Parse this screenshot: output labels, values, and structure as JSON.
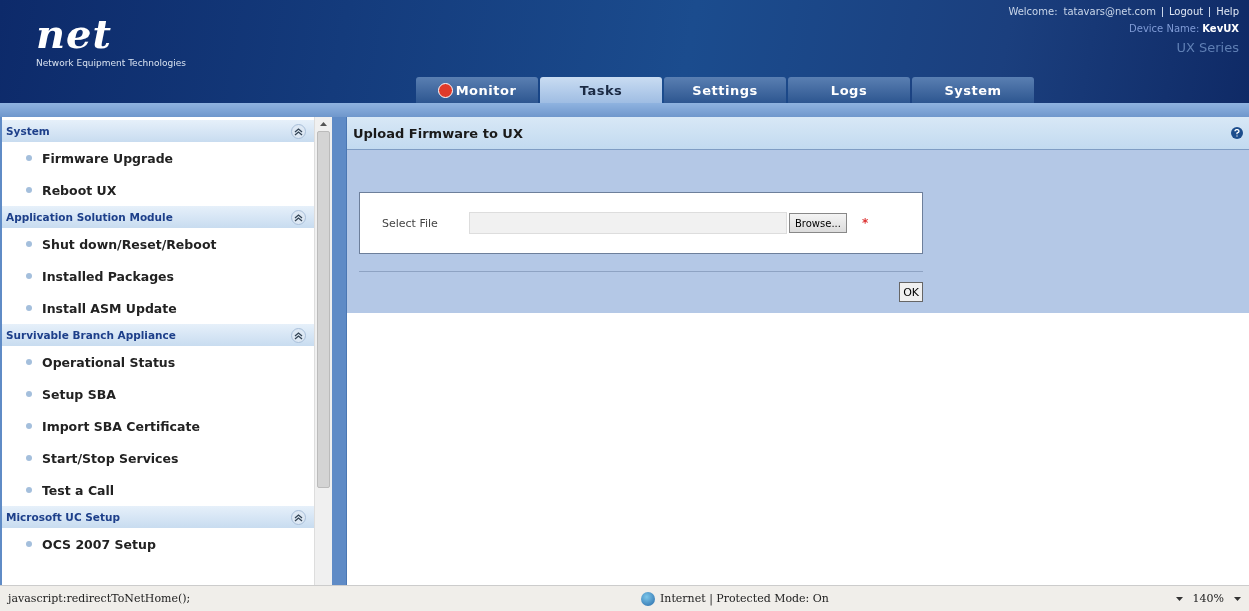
{
  "brand": {
    "logo": "net",
    "tagline": "Network Equipment Technologies"
  },
  "user_bar": {
    "welcome": "Welcome:",
    "user": "tatavars@net.com",
    "links": [
      "Logout",
      "Help"
    ],
    "device_label": "Device Name:",
    "device_name": "KevUX",
    "series": "UX Series"
  },
  "tabs": [
    {
      "label": "Monitor",
      "selected": false,
      "alert": true
    },
    {
      "label": "Tasks",
      "selected": true,
      "alert": false
    },
    {
      "label": "Settings",
      "selected": false,
      "alert": false
    },
    {
      "label": "Logs",
      "selected": false,
      "alert": false
    },
    {
      "label": "System",
      "selected": false,
      "alert": false
    }
  ],
  "sidebar": {
    "sections": [
      {
        "title": "System",
        "expanded": true,
        "items": [
          "Firmware Upgrade",
          "Reboot UX"
        ]
      },
      {
        "title": "Application Solution Module",
        "expanded": true,
        "items": [
          "Shut down/Reset/Reboot",
          "Installed Packages",
          "Install ASM Update"
        ]
      },
      {
        "title": "Survivable Branch Appliance",
        "expanded": true,
        "items": [
          "Operational Status",
          "Setup SBA",
          "Import SBA Certificate",
          "Start/Stop Services",
          "Test a Call"
        ]
      },
      {
        "title": "Microsoft UC Setup",
        "expanded": true,
        "items": [
          "OCS 2007 Setup"
        ]
      }
    ]
  },
  "panel": {
    "title": "Upload Firmware to UX",
    "field_label": "Select File",
    "browse": "Browse...",
    "required_mark": "*",
    "ok": "OK"
  },
  "status_bar": {
    "url": "javascript:redirectToNetHome();",
    "zone": "Internet | Protected Mode: On",
    "zoom": "140%"
  }
}
